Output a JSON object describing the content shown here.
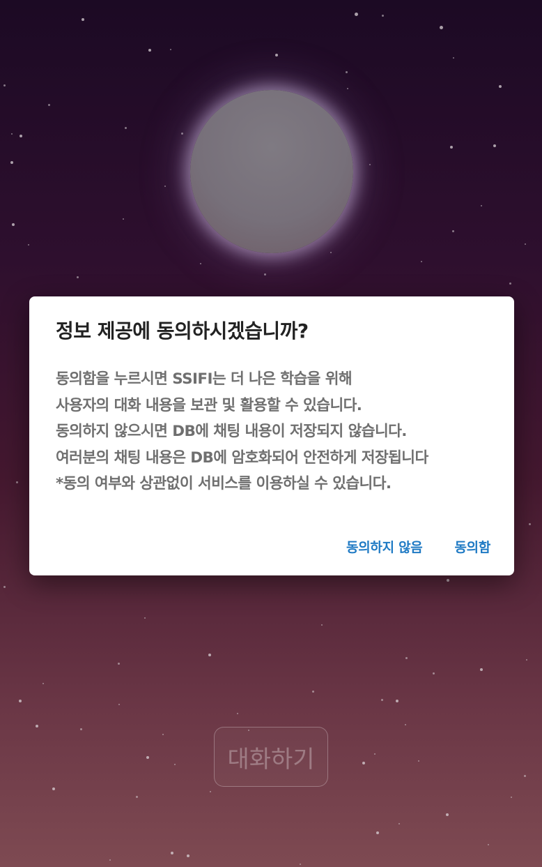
{
  "background": {
    "top_color": "#1c0a24",
    "bottom_color": "#7e4a52",
    "moon_color": "#7a757d",
    "moon_glow": "#dcc8f0"
  },
  "dialog": {
    "title": "정보 제공에 동의하시겠습니까?",
    "body_lines": [
      "동의함을 누르시면 SSIFI는 더 나은 학습을 위해",
      "사용자의 대화 내용을 보관 및 활용할 수 있습니다.",
      "동의하지 않으시면 DB에 채팅 내용이 저장되지 않습니다.",
      "여러분의 채팅 내용은 DB에 암호화되어 안전하게 저장됩니다",
      "*동의 여부와 상관없이 서비스를 이용하실 수 있습니다."
    ],
    "decline_label": "동의하지 않음",
    "accept_label": "동의함",
    "action_color": "#1f7ac4"
  },
  "start_button": {
    "label": "대화하기"
  }
}
